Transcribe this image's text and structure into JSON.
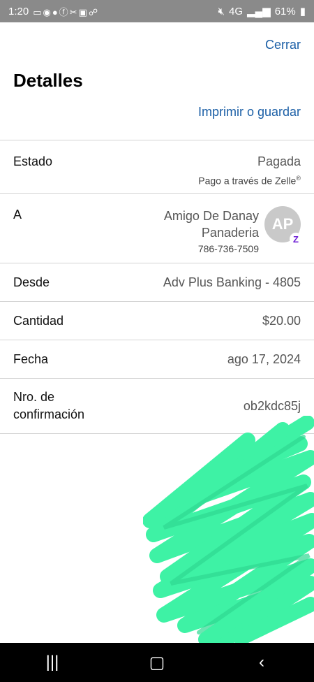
{
  "status_bar": {
    "time": "1:20",
    "network": "4G",
    "battery": "61%",
    "icons": [
      "video-icon",
      "whatsapp-icon",
      "chat-icon",
      "facebook-icon",
      "tools-icon",
      "gallery-icon",
      "incognito-icon",
      "mute-icon",
      "signal-icon",
      "battery-icon"
    ]
  },
  "header": {
    "close_label": "Cerrar",
    "title": "Detalles",
    "print_label": "Imprimir o guardar"
  },
  "details": {
    "estado": {
      "label": "Estado",
      "value": "Pagada",
      "sub": "Pago a través de Zelle"
    },
    "recipient": {
      "label": "A",
      "name_line1": "Amigo De Danay",
      "name_line2": "Panaderia",
      "phone": "786-736-7509",
      "avatar_initials": "AP",
      "badge": "Z"
    },
    "desde": {
      "label": "Desde",
      "value": "Adv Plus Banking - 4805"
    },
    "cantidad": {
      "label": "Cantidad",
      "value": "$20.00"
    },
    "fecha": {
      "label": "Fecha",
      "value": "ago 17, 2024"
    },
    "confirmacion": {
      "label_line1": "Nro. de",
      "label_line2": "confirmación",
      "value": "ob2kdc85j"
    }
  },
  "nav_bar": {
    "icons": [
      "recent-apps-icon",
      "home-icon",
      "back-icon"
    ]
  },
  "colors": {
    "link": "#1b5fa6",
    "scribble": "#3ef2a5",
    "zelle": "#6d1ed4",
    "status_bar": "#8a8a8a"
  }
}
